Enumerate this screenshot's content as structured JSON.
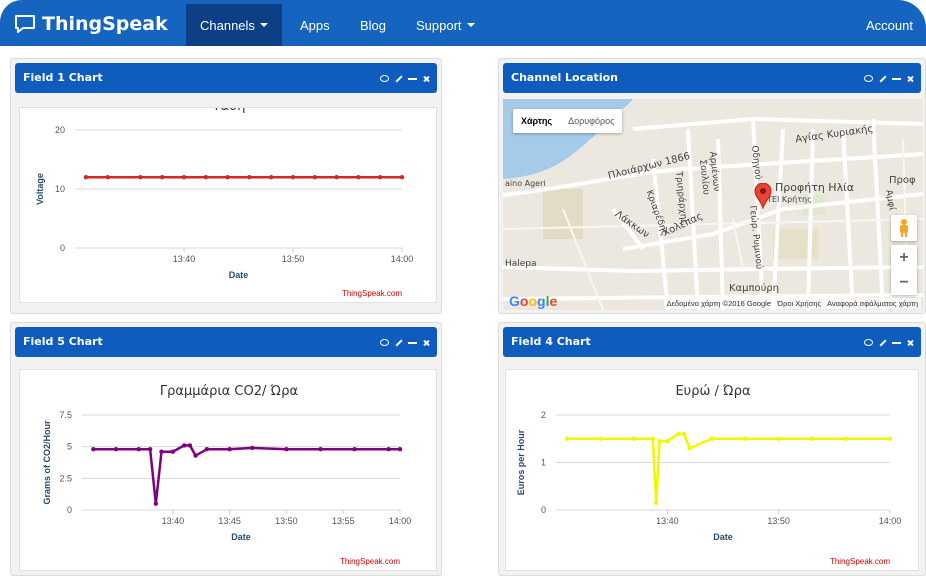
{
  "navbar": {
    "brand": "ThingSpeak",
    "items": [
      {
        "label": "Channels"
      },
      {
        "label": "Apps"
      },
      {
        "label": "Blog"
      },
      {
        "label": "Support"
      },
      {
        "label": "Account"
      }
    ]
  },
  "panels": {
    "field1": {
      "heading": "Field 1 Chart"
    },
    "location": {
      "heading": "Channel Location"
    },
    "field5": {
      "heading": "Field 5 Chart"
    },
    "field4": {
      "heading": "Field 4 Chart"
    }
  },
  "map": {
    "toggle": [
      "Χάρτης",
      "Δορυφόρος"
    ],
    "labels": [
      "Αγίας Κυριακής",
      "Πλοιάρχων 1866",
      "Αρμένων",
      "Σουλίου",
      "Τριηράρχης",
      "Κριαρέδης",
      "Λάκκων",
      "Χολέπας",
      "Οδηγού",
      "Προφήτη Ηλία",
      "ΤΕΙ Κρήτης",
      "Γεώρ. Ρυμινού",
      "Καμπούρη",
      "Halepa",
      "aino Ageri",
      "Αμφί",
      "Προφ"
    ],
    "footer_data": "Δεδομένα χάρτη ©2016 Google",
    "footer_terms": "Όροι Χρήσης",
    "footer_report": "Αναφορά σφάλματος χάρτη",
    "google": "Google",
    "marker_color": "#ea4335",
    "zoom_in": "+",
    "zoom_out": "−"
  },
  "chart_data": [
    {
      "type": "line",
      "title": "Τάση",
      "xlabel": "Date",
      "ylabel": "Voltage",
      "x_ticks": [
        "13:40",
        "13:50",
        "14:00"
      ],
      "y_ticks": [
        "0",
        "10",
        "20"
      ],
      "ylim": [
        0,
        20
      ],
      "series_color": "#d62728",
      "series": [
        {
          "x": [
            "13:31",
            "13:33",
            "13:36",
            "13:38",
            "13:40",
            "13:42",
            "13:44",
            "13:46",
            "13:48",
            "13:50",
            "13:52",
            "13:54",
            "13:56",
            "13:58",
            "14:00"
          ],
          "values": [
            12,
            12,
            12,
            12,
            12,
            12,
            12,
            12,
            12,
            12,
            12,
            12,
            12,
            12,
            12
          ]
        }
      ],
      "credit": "ThingSpeak.com"
    },
    {
      "type": "line",
      "title": "Γραμμάρια CO2/ Ώρα",
      "xlabel": "Date",
      "ylabel": "Grams of CO2/Hour",
      "x_ticks": [
        "13:40",
        "13:45",
        "13:50",
        "13:55",
        "14:00"
      ],
      "y_ticks": [
        "0",
        "2.5",
        "5",
        "7.5"
      ],
      "ylim": [
        0,
        7.5
      ],
      "series_color": "#800080",
      "series": [
        {
          "x": [
            "13:33",
            "13:35",
            "13:37",
            "13:38",
            "13:38.5",
            "13:39",
            "13:40",
            "13:41",
            "13:41.5",
            "13:42",
            "13:43",
            "13:45",
            "13:47",
            "13:50",
            "13:53",
            "13:56",
            "13:59",
            "14:00"
          ],
          "values": [
            4.8,
            4.8,
            4.8,
            4.8,
            0.5,
            4.6,
            4.6,
            5.1,
            5.1,
            4.3,
            4.8,
            4.8,
            4.9,
            4.8,
            4.8,
            4.8,
            4.8,
            4.8
          ]
        }
      ],
      "credit": "ThingSpeak.com"
    },
    {
      "type": "line",
      "title": "Ευρώ / Ώρα",
      "xlabel": "Date",
      "ylabel": "Euros per Hour",
      "x_ticks": [
        "13:40",
        "13:50",
        "14:00"
      ],
      "y_ticks": [
        "0",
        "1",
        "2"
      ],
      "ylim": [
        0,
        2
      ],
      "series_color": "#f5f500",
      "series": [
        {
          "x": [
            "13:31",
            "13:34",
            "13:37",
            "13:38.7",
            "13:39",
            "13:39.3",
            "13:40",
            "13:41",
            "13:41.5",
            "13:42",
            "13:44",
            "13:47",
            "13:50",
            "13:53",
            "13:56",
            "14:00"
          ],
          "values": [
            1.5,
            1.5,
            1.5,
            1.5,
            0.15,
            1.45,
            1.45,
            1.6,
            1.6,
            1.3,
            1.5,
            1.5,
            1.5,
            1.5,
            1.5,
            1.5
          ]
        }
      ],
      "credit": "ThingSpeak.com"
    }
  ]
}
